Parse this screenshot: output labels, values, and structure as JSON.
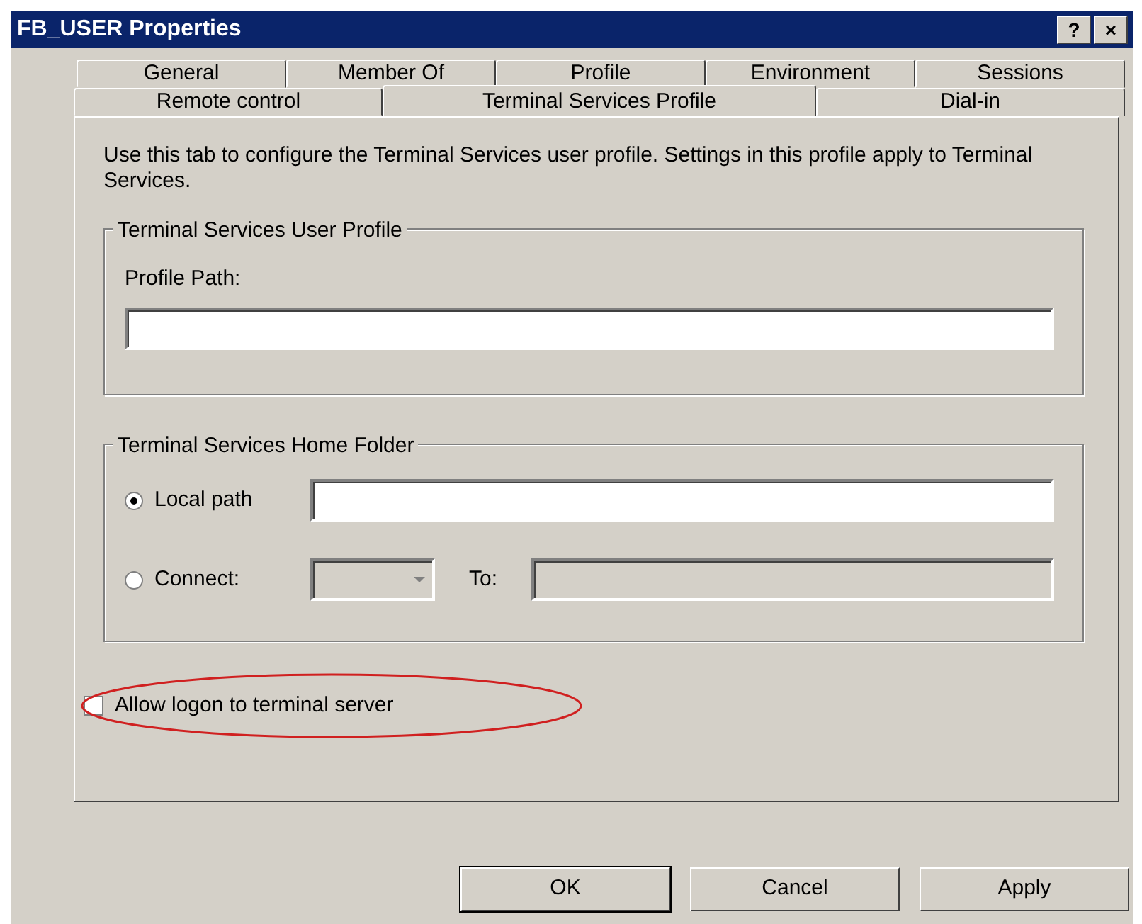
{
  "window": {
    "title": "FB_USER Properties",
    "title_buttons": [
      "?",
      "×"
    ]
  },
  "tab_rows": [
    [
      {
        "label": "General",
        "selected": false
      },
      {
        "label": "Member Of",
        "selected": false
      },
      {
        "label": "Profile",
        "selected": false
      },
      {
        "label": "Environment",
        "selected": false
      },
      {
        "label": "Sessions",
        "selected": false
      }
    ],
    [
      {
        "label": "Remote control",
        "selected": false
      },
      {
        "label": "Terminal Services Profile",
        "selected": true
      },
      {
        "label": "Dial-in",
        "selected": false
      }
    ]
  ],
  "intro": "Use this tab to configure the Terminal Services user profile. Settings in this profile apply to Terminal Services.",
  "profile_group": {
    "title": "Terminal Services User Profile",
    "label": "Profile Path:"
  },
  "home_group": {
    "title": "Terminal Services Home Folder",
    "options": [
      {
        "label": "Local path",
        "selected": true
      },
      {
        "label": "Connect:",
        "selected": false,
        "to_label": "To:"
      }
    ]
  },
  "checkbox": {
    "label": "Allow logon to terminal server",
    "checked": false,
    "circled": true
  },
  "buttons": [
    {
      "label": "OK",
      "default": true
    },
    {
      "label": "Cancel",
      "default": false
    },
    {
      "label": "Apply",
      "default": false
    }
  ]
}
